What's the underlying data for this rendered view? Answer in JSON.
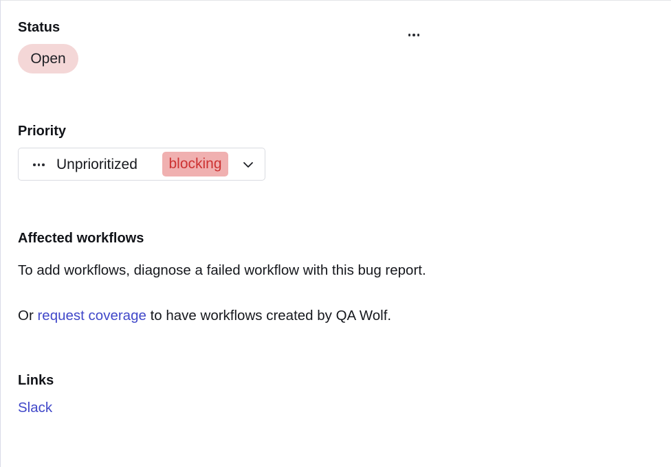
{
  "status": {
    "title": "Status",
    "value": "Open"
  },
  "more_menu": {
    "icon": "more-horizontal-icon"
  },
  "priority": {
    "title": "Priority",
    "value": "Unprioritized",
    "badge": "blocking",
    "icons": {
      "leading": "more-horizontal-icon",
      "trailing": "chevron-down-icon"
    }
  },
  "affected_workflows": {
    "title": "Affected workflows",
    "description": "To add workflows, diagnose a failed workflow with this bug report.",
    "coverage_prefix": "Or ",
    "coverage_link": "request coverage",
    "coverage_suffix": " to have workflows created by QA Wolf."
  },
  "links": {
    "title": "Links",
    "items": [
      "Slack"
    ]
  },
  "colors": {
    "status_pill_bg": "#f4d7d7",
    "blocking_bg": "#f0b0b0",
    "blocking_text": "#cd3232",
    "link": "#4148c9"
  }
}
